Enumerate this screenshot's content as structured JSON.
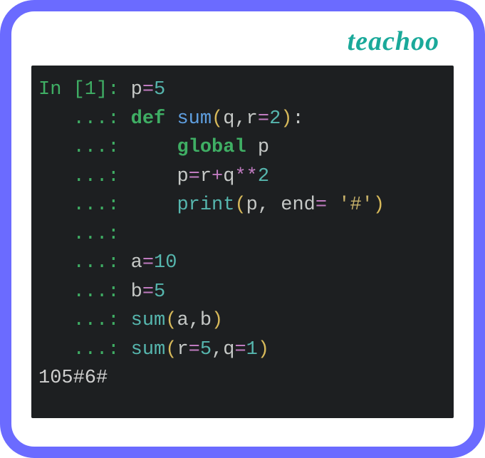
{
  "brand": "teachoo",
  "code": {
    "in_label": "In [1]: ",
    "cont_label": "   ...: ",
    "lines": {
      "l1": {
        "a": "p",
        "b": "=",
        "c": "5"
      },
      "l2": {
        "kw": "def",
        "sp": " ",
        "fn": "sum",
        "lp": "(",
        "q": "q",
        "c1": ",",
        "r": "r",
        "eq": "=",
        "two": "2",
        "rp": ")",
        "colon": ":"
      },
      "l3": {
        "pad": "    ",
        "kw1": "global",
        "sp": " ",
        "p": "p"
      },
      "l4": {
        "pad": "    ",
        "p": "p",
        "eq": "=",
        "r": "r",
        "plus": "+",
        "q": "q",
        "pow": "**",
        "two": "2"
      },
      "l5": {
        "pad": "    ",
        "fn": "print",
        "lp": "(",
        "p": "p",
        "cm": ", ",
        "end": "end",
        "eq": "=",
        "sp": " ",
        "str": "'#'",
        "rp": ")"
      },
      "blank": "",
      "l7": {
        "a": "a",
        "eq": "=",
        "v": "10"
      },
      "l8": {
        "b": "b",
        "eq": "=",
        "v": "5"
      },
      "l9": {
        "fn": "sum",
        "lp": "(",
        "a": "a",
        "cm": ",",
        "b": "b",
        "rp": ")"
      },
      "l10": {
        "fn": "sum",
        "lp": "(",
        "r": "r",
        "eq1": "=",
        "v1": "5",
        "cm": ",",
        "q": "q",
        "eq2": "=",
        "v2": "1",
        "rp": ")"
      }
    },
    "output": "105#6#"
  }
}
